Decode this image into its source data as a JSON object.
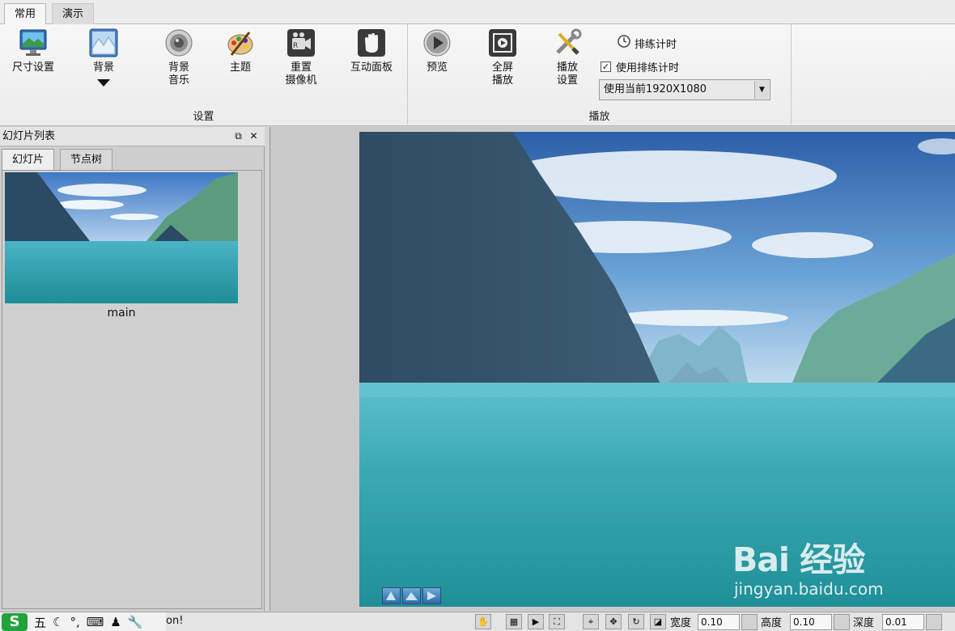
{
  "tabs": [
    {
      "label": "常用",
      "active": true
    },
    {
      "label": "演示",
      "active": false
    }
  ],
  "ribbon": {
    "settings": {
      "group_label": "设置",
      "size_label": "尺寸设置",
      "background_label": "背景",
      "music_line1": "背景",
      "music_line2": "音乐",
      "theme_label": "主题",
      "camera_line1": "重置",
      "camera_line2": "摄像机",
      "interactive_label": "互动面板"
    },
    "playback": {
      "group_label": "播放",
      "preview_label": "预览",
      "fullscreen_line1": "全屏",
      "fullscreen_line2": "播放",
      "playset_line1": "播放",
      "playset_line2": "设置",
      "timer_label": "排练计时",
      "use_timer_label": "使用排练计时",
      "use_timer_checked": true,
      "resolution_value": "使用当前1920X1080"
    }
  },
  "slide_panel": {
    "title": "幻灯片列表",
    "tabs": [
      "幻灯片",
      "节点树"
    ],
    "slides": [
      {
        "name": "main"
      }
    ]
  },
  "status": {
    "ime_chars": [
      "五"
    ],
    "message": "on!",
    "width_label": "宽度",
    "width_value": "0.10",
    "height_label": "高度",
    "height_value": "0.10",
    "depth_label": "深度",
    "depth_value": "0.01"
  },
  "watermark": {
    "main": "Bai 经验",
    "sub": "jingyan.baidu.com"
  }
}
